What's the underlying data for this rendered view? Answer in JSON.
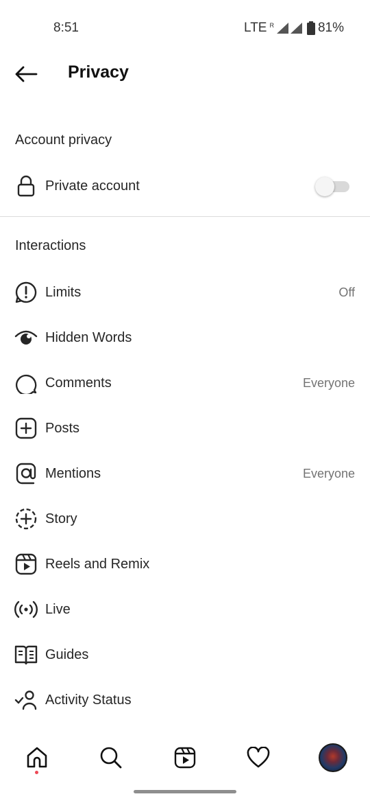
{
  "status_bar": {
    "time": "8:51",
    "network": "LTE",
    "roaming": "R",
    "battery": "81%"
  },
  "header": {
    "title": "Privacy"
  },
  "account_privacy": {
    "section_title": "Account privacy",
    "private_account": {
      "label": "Private account",
      "enabled": false
    }
  },
  "interactions": {
    "section_title": "Interactions",
    "items": [
      {
        "label": "Limits",
        "value": "Off",
        "icon": "limits-icon"
      },
      {
        "label": "Hidden Words",
        "value": "",
        "icon": "hidden-words-icon"
      },
      {
        "label": "Comments",
        "value": "Everyone",
        "icon": "comment-icon"
      },
      {
        "label": "Posts",
        "value": "",
        "icon": "add-post-icon"
      },
      {
        "label": "Mentions",
        "value": "Everyone",
        "icon": "mention-icon"
      },
      {
        "label": "Story",
        "value": "",
        "icon": "story-icon"
      },
      {
        "label": "Reels and Remix",
        "value": "",
        "icon": "reels-icon"
      },
      {
        "label": "Live",
        "value": "",
        "icon": "live-icon"
      },
      {
        "label": "Guides",
        "value": "",
        "icon": "guides-icon"
      },
      {
        "label": "Activity Status",
        "value": "",
        "icon": "activity-status-icon"
      }
    ]
  },
  "bottom_nav": [
    "home-icon",
    "search-icon",
    "reels-icon",
    "heart-icon",
    "profile-avatar"
  ],
  "colors": {
    "text": "#262626",
    "secondary": "#737373",
    "divider": "#dbdbdb",
    "notification_dot": "#ed4956"
  }
}
